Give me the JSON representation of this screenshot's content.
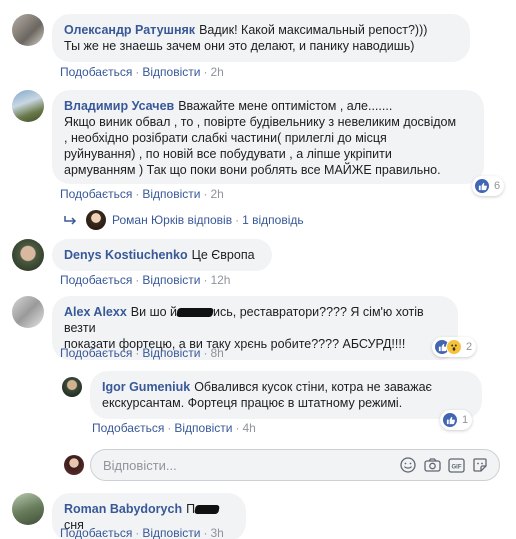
{
  "comments": [
    {
      "author": "Олександр Ратушняк",
      "text": "Вадик! Какой максимальный репост?)))\nТы же не знаешь зачем они это делают, и панику наводишь)",
      "like": "Подобається",
      "reply": "Відповісти",
      "time": "2h"
    },
    {
      "author": "Владимир Усачев",
      "text": "Вважайте мене оптимістом , але.......\nЯкщо виник обвал , то , повірте будівельнику з невеликим досвідом\n, необхідно розібрати слабкі частини( прилеглі до місця\nруйнування) , по новій все побудувати , а ліпше укріпити\nармуванням ) Так що поки вони роблять все МАЙЖЕ правильно.",
      "like": "Подобається",
      "reply": "Відповісти",
      "time": "2h",
      "reaction_count": "6",
      "replies_author": "Роман Юрків відповів",
      "replies_count": "1 відповідь"
    },
    {
      "author": "Denys Kostiuchenko",
      "text": "Це Європа",
      "like": "Подобається",
      "reply": "Відповісти",
      "time": "12h"
    },
    {
      "author": "Alex Alexx",
      "text_before": "Ви шо й",
      "text_after": "ись, реставратори???? Я сім'ю хотів везти\nпоказати фортецю, а ви таку хрєнь робите???? АБСУРД!!!!",
      "like": "Подобається",
      "reply": "Відповісти",
      "time": "8h",
      "reaction_count": "2"
    },
    {
      "author": "Igor Gumeniuk",
      "text": "Обвалився кусок стіни, котра не заважає\nекскурсантам. Фортеця працює в штатному режимі.",
      "like": "Подобається",
      "reply": "Відповісти",
      "time": "4h",
      "reaction_count": "1"
    },
    {
      "author": "Roman Babydorych",
      "text_before": "П",
      "text_after": "сня",
      "like": "Подобається",
      "reply": "Відповісти",
      "time": "3h"
    }
  ],
  "reply_input": {
    "placeholder": "Відповісти..."
  },
  "colors": {
    "link": "#385898",
    "bubble": "#f2f3f5",
    "meta": "#90949c",
    "like": "#4267b2"
  },
  "icons": [
    "reply-arrow-icon",
    "like-reaction-icon",
    "wow-reaction-icon",
    "emoji-icon",
    "camera-icon",
    "gif-icon",
    "sticker-icon"
  ]
}
